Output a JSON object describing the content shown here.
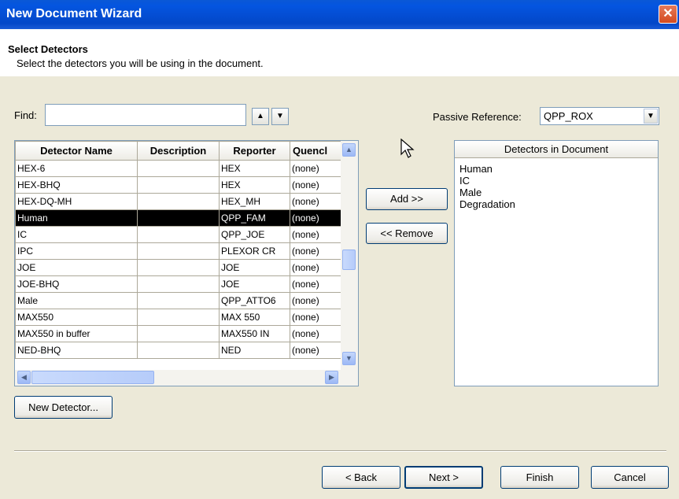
{
  "window": {
    "title": "New Document Wizard",
    "close_glyph": "✕"
  },
  "header": {
    "title": "Select Detectors",
    "subtitle": "Select the detectors you will be using in the document."
  },
  "find": {
    "label": "Find:",
    "value": "",
    "up_glyph": "▲",
    "down_glyph": "▼"
  },
  "passive_reference": {
    "label": "Passive Reference:",
    "value": "QPP_ROX"
  },
  "detector_table": {
    "columns": [
      "Detector Name",
      "Description",
      "Reporter",
      "Quencl"
    ],
    "rows": [
      {
        "name": "HEX-6",
        "description": "",
        "reporter": "HEX",
        "quencher": "(none)"
      },
      {
        "name": "HEX-BHQ",
        "description": "",
        "reporter": "HEX",
        "quencher": "(none)"
      },
      {
        "name": "HEX-DQ-MH",
        "description": "",
        "reporter": "HEX_MH",
        "quencher": "(none)"
      },
      {
        "name": "Human",
        "description": "",
        "reporter": "QPP_FAM",
        "quencher": "(none)",
        "selected": true
      },
      {
        "name": "IC",
        "description": "",
        "reporter": "QPP_JOE",
        "quencher": "(none)"
      },
      {
        "name": "IPC",
        "description": "",
        "reporter": "PLEXOR CR",
        "quencher": "(none)"
      },
      {
        "name": "JOE",
        "description": "",
        "reporter": "JOE",
        "quencher": "(none)"
      },
      {
        "name": "JOE-BHQ",
        "description": "",
        "reporter": "JOE",
        "quencher": "(none)"
      },
      {
        "name": "Male",
        "description": "",
        "reporter": "QPP_ATTO6",
        "quencher": "(none)"
      },
      {
        "name": "MAX550",
        "description": "",
        "reporter": "MAX 550",
        "quencher": "(none)"
      },
      {
        "name": "MAX550 in buffer",
        "description": "",
        "reporter": "MAX550 IN",
        "quencher": "(none)"
      },
      {
        "name": "NED-BHQ",
        "description": "",
        "reporter": "NED",
        "quencher": "(none)"
      }
    ]
  },
  "buttons": {
    "add": "Add >>",
    "remove": "<< Remove",
    "new_detector": "New Detector...",
    "back": "< Back",
    "next": "Next >",
    "finish": "Finish",
    "cancel": "Cancel"
  },
  "detectors_in_document": {
    "header": "Detectors in Document",
    "items": [
      "Human",
      "IC",
      "Male",
      "Degradation"
    ]
  },
  "icons": {
    "scroll_up": "▲",
    "scroll_down": "▼",
    "scroll_left": "◀",
    "scroll_right": "▶",
    "dropdown": "▼"
  },
  "colors": {
    "titlebar": "#0455e0",
    "selection": "#000000",
    "dialog_bg": "#ece9d8"
  }
}
